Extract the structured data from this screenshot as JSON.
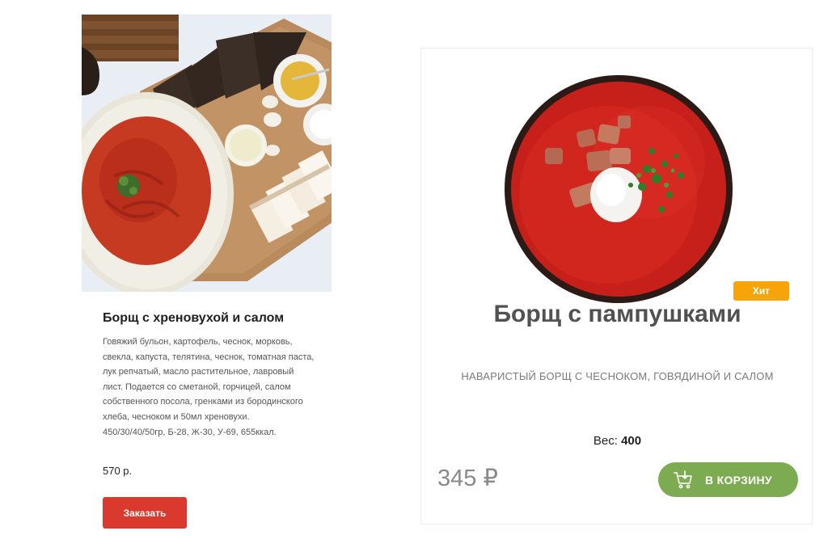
{
  "left_card": {
    "title": "Борщ с хреновухой и салом",
    "description": "Говяжий бульон, картофель, чеснок, морковь, свекла, капуста, телятина, чеснок, томатная паста, лук репчатый, масло растительное, лавровый лист. Подается со сметаной, горчицей, салом собственного посола, гренками из бородинского хлеба, чесноком и 50мл хреновухи. 450/30/40/50гр, Б-28, Ж-30, У-69, 655ккал.",
    "price": "570 р.",
    "order_button": "Заказать",
    "image": "borscht-with-bread-and-salo-photo"
  },
  "right_card": {
    "badge": "Хит",
    "title": "Борщ с пампушками",
    "subtitle": "НАВАРИСТЫЙ БОРЩ С ЧЕСНОКОМ, ГОВЯДИНОЙ И САЛОМ",
    "weight_label": "Вес:",
    "weight_value": "400",
    "price": "345 ₽",
    "cart_button": "В КОРЗИНУ",
    "cart_icon": "cart-icon",
    "image": "borscht-bowl-top-view-photo"
  },
  "colors": {
    "order_button": "#d93a2d",
    "badge": "#f6a40a",
    "cart_button": "#7dab51"
  }
}
